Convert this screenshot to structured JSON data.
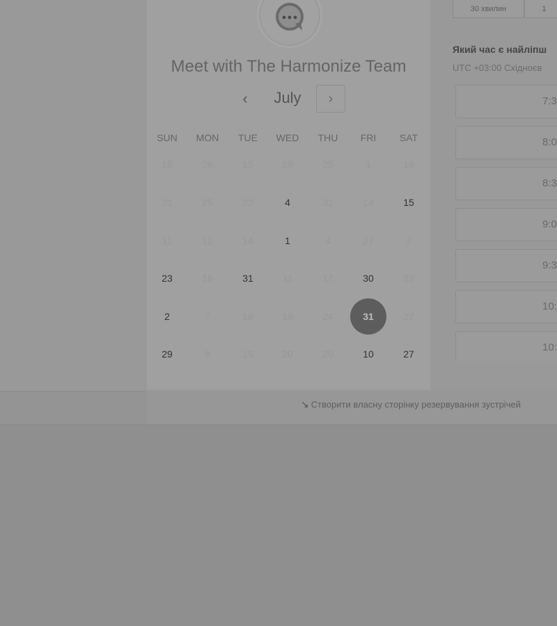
{
  "booking": {
    "title": "Meet with The Harmonize Team",
    "month": "July",
    "prev_icon": "‹",
    "next_icon": "›",
    "weekdays": [
      "SUN",
      "MON",
      "TUE",
      "WED",
      "THU",
      "FRI",
      "SAT"
    ],
    "weeks": [
      [
        {
          "d": "16",
          "a": false
        },
        {
          "d": "26",
          "a": false
        },
        {
          "d": "15",
          "a": false
        },
        {
          "d": "28",
          "a": false
        },
        {
          "d": "25",
          "a": false
        },
        {
          "d": "1",
          "a": false
        },
        {
          "d": "18",
          "a": false
        }
      ],
      [
        {
          "d": "31",
          "a": false
        },
        {
          "d": "25",
          "a": false
        },
        {
          "d": "22",
          "a": false
        },
        {
          "d": "4",
          "a": true
        },
        {
          "d": "31",
          "a": false
        },
        {
          "d": "14",
          "a": false
        },
        {
          "d": "15",
          "a": true
        }
      ],
      [
        {
          "d": "11",
          "a": false
        },
        {
          "d": "12",
          "a": false
        },
        {
          "d": "14",
          "a": false
        },
        {
          "d": "1",
          "a": true
        },
        {
          "d": "4",
          "a": false
        },
        {
          "d": "27",
          "a": false
        },
        {
          "d": "3",
          "a": false
        }
      ],
      [
        {
          "d": "23",
          "a": true
        },
        {
          "d": "16",
          "a": false
        },
        {
          "d": "31",
          "a": true
        },
        {
          "d": "11",
          "a": false
        },
        {
          "d": "17",
          "a": false
        },
        {
          "d": "30",
          "a": true
        },
        {
          "d": "22",
          "a": false
        }
      ],
      [
        {
          "d": "2",
          "a": true
        },
        {
          "d": "7",
          "a": false
        },
        {
          "d": "18",
          "a": false
        },
        {
          "d": "19",
          "a": false
        },
        {
          "d": "24",
          "a": false
        },
        {
          "d": "31",
          "a": true,
          "selected": true
        },
        {
          "d": "27",
          "a": false
        }
      ],
      [
        {
          "d": "29",
          "a": true
        },
        {
          "d": "8",
          "a": false
        },
        {
          "d": "19",
          "a": false
        },
        {
          "d": "20",
          "a": false
        },
        {
          "d": "20",
          "a": false
        },
        {
          "d": "10",
          "a": true
        },
        {
          "d": "27",
          "a": true
        }
      ]
    ]
  },
  "duration_tabs": [
    "30 хвилин",
    "1"
  ],
  "time_question": "Який час є найліпш",
  "timezone": "UTC +03:00 Східноєв",
  "time_slots": [
    "7:3",
    "8:0",
    "8:3",
    "9:0",
    "9:3",
    "10:",
    "10:"
  ],
  "footer_link": "Створити власну сторінку резервування зустрічей",
  "footer_icon": "↘",
  "logo_icon": "chat-bubble-icon",
  "colors": {
    "overlay_bg": "#999999",
    "selected_day": "#5d5d5d"
  }
}
